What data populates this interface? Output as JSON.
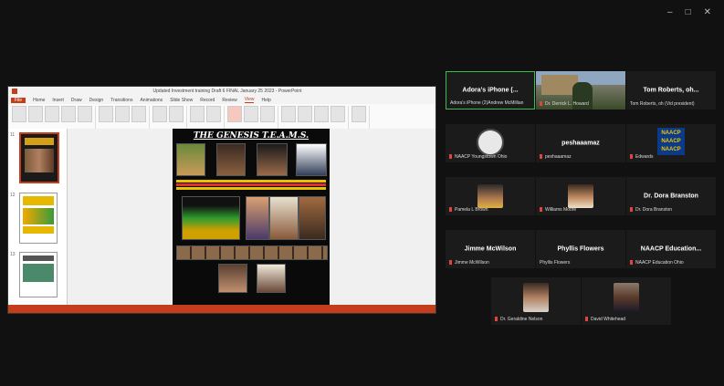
{
  "window": {
    "controls": [
      "–",
      "□",
      "✕"
    ]
  },
  "share": {
    "titlebar": "Updated Investment training Draft 6 FINAL January 25 2023 - PowerPoint",
    "tabs": [
      "File",
      "Home",
      "Insert",
      "Draw",
      "Design",
      "Transitions",
      "Animations",
      "Slide Show",
      "Record",
      "Review",
      "View",
      "Help"
    ],
    "slide_title": "THE GENESIS T.E.A.M.S.",
    "thumb_numbers": [
      "11",
      "12",
      "13"
    ]
  },
  "gallery": {
    "tiles": [
      {
        "label": "Adora's iPhone (...",
        "name": "Adora's iPhone (2)Andrew McMillian",
        "kind": "text",
        "active": true
      },
      {
        "label": "",
        "name": "Dr. Derrick L. Howard",
        "kind": "video"
      },
      {
        "label": "Tom Roberts, oh...",
        "name": "Tom Roberts, oh (Vid president)",
        "kind": "text"
      },
      {
        "label": "",
        "name": "NAACP Youngstown Ohio",
        "kind": "seal"
      },
      {
        "label": "peshaaamaz",
        "name": "peshaaamaz",
        "kind": "text"
      },
      {
        "label": "",
        "name": "Edwards",
        "kind": "naacp"
      },
      {
        "label": "",
        "name": "Pamela L Brown",
        "kind": "photo"
      },
      {
        "label": "",
        "name": "Williams Moore",
        "kind": "photo"
      },
      {
        "label": "Dr. Dora Branston",
        "name": "Dr. Dora Branston",
        "kind": "text"
      },
      {
        "label": "Jimme McWilson",
        "name": "Jimme McWilson",
        "kind": "text"
      },
      {
        "label": "Phyllis Flowers",
        "name": "Phyllis Flowers",
        "kind": "text"
      },
      {
        "label": "NAACP Education...",
        "name": "NAACP Education Ohio",
        "kind": "text"
      },
      {
        "label": "",
        "name": "Dr. Geraldine Nelson",
        "kind": "photo"
      },
      {
        "label": "",
        "name": "David Whitehead",
        "kind": "photo"
      }
    ],
    "naacp_text": [
      "NAACP",
      "NAACP",
      "NAACP"
    ]
  }
}
